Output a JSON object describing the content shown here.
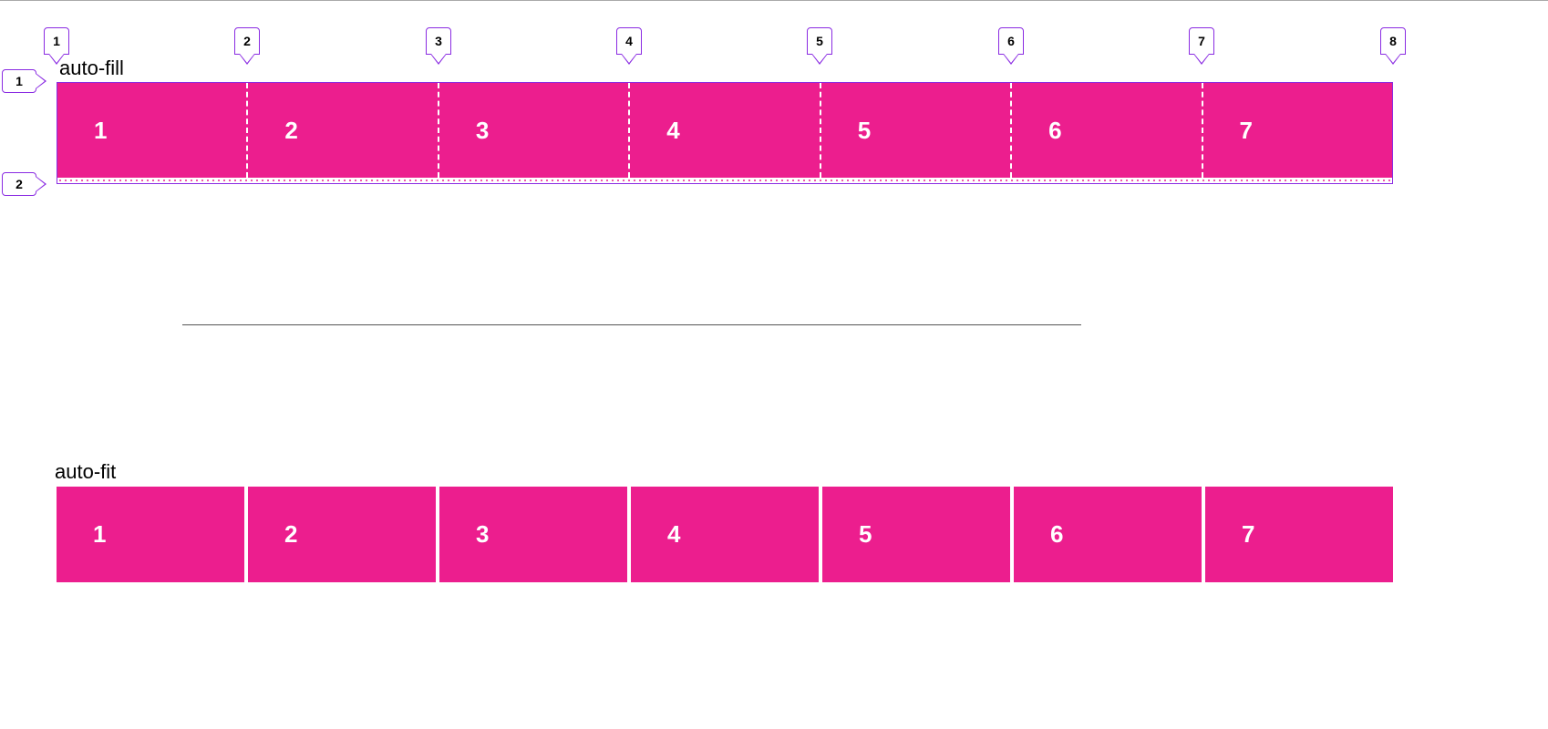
{
  "colors": {
    "accent": "#ec1e8e",
    "markerBorder": "#8a2be2"
  },
  "top": {
    "label": "auto-fill",
    "colMarkers": [
      "1",
      "2",
      "3",
      "4",
      "5",
      "6",
      "7",
      "8"
    ],
    "rowMarkers": [
      "1",
      "2"
    ],
    "cells": [
      "1",
      "2",
      "3",
      "4",
      "5",
      "6",
      "7"
    ]
  },
  "bottom": {
    "label": "auto-fit",
    "cells": [
      "1",
      "2",
      "3",
      "4",
      "5",
      "6",
      "7"
    ]
  },
  "layout": {
    "gridLeft": 62,
    "gridWidth": 1466,
    "colMarkerXs": [
      62,
      271,
      481,
      690,
      899,
      1109,
      1318,
      1528
    ],
    "rowMarkerYs": [
      76,
      189
    ],
    "labelTopY": 62,
    "labelBottomY": 505
  }
}
